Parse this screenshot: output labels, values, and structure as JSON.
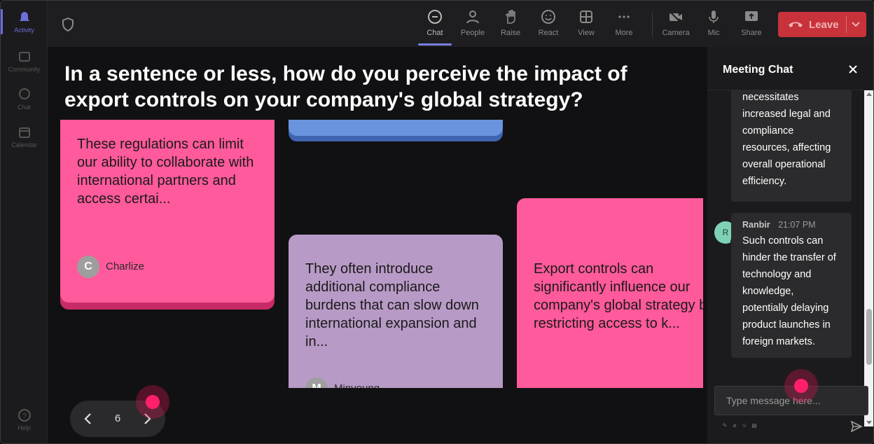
{
  "rail": {
    "items": [
      {
        "label": "Activity",
        "icon": "bell-icon",
        "active": true
      },
      {
        "label": "Community",
        "icon": "community-icon"
      },
      {
        "label": "Chat",
        "icon": "chat-icon"
      },
      {
        "label": "Calendar",
        "icon": "calendar-icon"
      },
      {
        "label": "Help",
        "icon": "help-icon"
      }
    ]
  },
  "toolbar": {
    "buttons": [
      {
        "label": "Chat",
        "icon": "chat-bubble-icon"
      },
      {
        "label": "People",
        "icon": "people-icon"
      },
      {
        "label": "Raise",
        "icon": "raise-hand-icon"
      },
      {
        "label": "React",
        "icon": "smiley-icon"
      },
      {
        "label": "View",
        "icon": "grid-view-icon"
      },
      {
        "label": "More",
        "icon": "more-icon"
      },
      {
        "label": "Camera",
        "icon": "camera-off-icon"
      },
      {
        "label": "Mic",
        "icon": "mic-icon"
      },
      {
        "label": "Share",
        "icon": "share-icon"
      }
    ],
    "leave_label": "Leave",
    "leave_color": "#c8323a"
  },
  "main": {
    "question": "In a sentence or less, how do you perceive the impact of export controls on your company's global strategy?",
    "cards": [
      {
        "text": "These regulations can limit our ability to collaborate with international partners and access certai...",
        "author": "Charlize",
        "initial": "C",
        "color": "#ff5a9b"
      },
      {
        "text": "",
        "author": "",
        "initial": "",
        "color": "#6a94de"
      },
      {
        "text": "They often introduce additional compliance burdens that can slow down international expansion and in...",
        "author": "Minyoung",
        "initial": "M",
        "color": "#b89ac6"
      },
      {
        "text": "Export controls can significantly influence our company's global strategy by restricting access to k...",
        "author": "",
        "initial": "",
        "color": "#ff5a9b"
      }
    ]
  },
  "pager": {
    "page": "6"
  },
  "chat": {
    "title": "Meeting Chat",
    "messages": [
      {
        "text_lines": [
          "necessitates",
          "increased legal and",
          "compliance",
          "resources, affecting",
          "overall operational",
          "efficiency."
        ]
      },
      {
        "name": "Ranbir",
        "initial": "R",
        "time": "21:07 PM",
        "text_lines": [
          "Such controls can",
          "hinder the transfer of",
          "technology and",
          "knowledge,",
          "potentially delaying",
          "product launches in",
          "foreign markets."
        ]
      }
    ],
    "input_placeholder": "Type message here..."
  }
}
